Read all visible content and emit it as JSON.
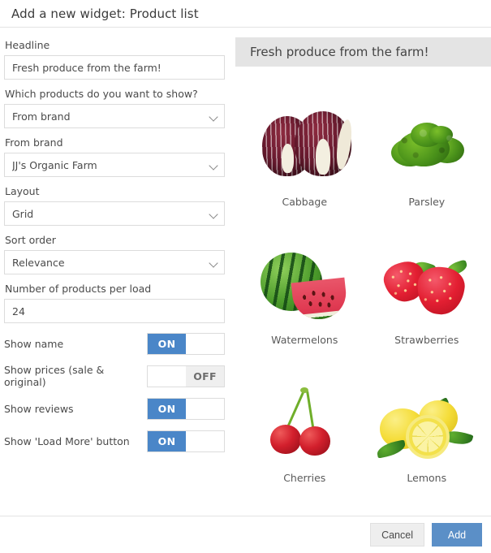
{
  "dialog": {
    "title": "Add a new widget: Product list"
  },
  "form": {
    "headline": {
      "label": "Headline",
      "value": "Fresh produce from the farm!"
    },
    "which_products": {
      "label": "Which products do you want to show?",
      "value": "From brand"
    },
    "from_brand": {
      "label": "From brand",
      "value": "JJ's Organic Farm"
    },
    "layout": {
      "label": "Layout",
      "value": "Grid"
    },
    "sort_order": {
      "label": "Sort order",
      "value": "Relevance"
    },
    "per_load": {
      "label": "Number of products per load",
      "value": "24"
    },
    "toggles": [
      {
        "label": "Show name",
        "state": "ON",
        "on_label": "ON",
        "off_label": "OFF"
      },
      {
        "label": "Show prices (sale & original)",
        "state": "OFF",
        "on_label": "ON",
        "off_label": "OFF"
      },
      {
        "label": "Show reviews",
        "state": "ON",
        "on_label": "ON",
        "off_label": "OFF"
      },
      {
        "label": "Show 'Load More' button",
        "state": "ON",
        "on_label": "ON",
        "off_label": "OFF"
      }
    ]
  },
  "preview": {
    "header": "Fresh produce from the farm!",
    "products": [
      {
        "name": "Cabbage",
        "image": "cabbage-image"
      },
      {
        "name": "Parsley",
        "image": "parsley-image"
      },
      {
        "name": "Watermelons",
        "image": "watermelons-image"
      },
      {
        "name": "Strawberries",
        "image": "strawberries-image"
      },
      {
        "name": "Cherries",
        "image": "cherries-image"
      },
      {
        "name": "Lemons",
        "image": "lemons-image"
      }
    ]
  },
  "footer": {
    "cancel_label": "Cancel",
    "add_label": "Add"
  },
  "colors": {
    "accent_button": "#5b8fc7",
    "toggle_on": "#4a86c8",
    "preview_header_bg": "#e4e4e4",
    "border": "#dcdcdc",
    "text": "#4a4a4a"
  }
}
